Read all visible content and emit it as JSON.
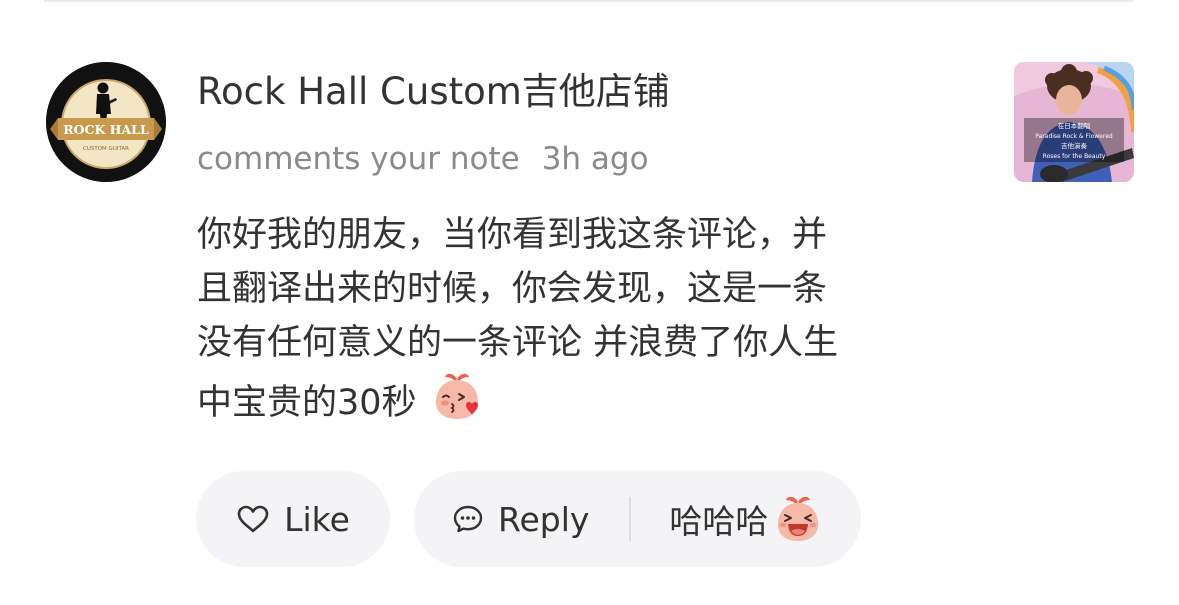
{
  "comment": {
    "avatar": {
      "icon": "rock-hall-logo-icon",
      "brand_text": "ROCK HALL",
      "sub_text": "CUSTOM GUITAR"
    },
    "author": "Rock Hall Custom吉他店铺",
    "action": "comments your note",
    "time": "3h ago",
    "text_lines": [
      "你好我的朋友，当你看到我这条评论，并",
      "且翻译出来的时候，你会发现，这是一条",
      "没有任何意义的一条评论 并浪费了你人生",
      "中宝贵的30秒"
    ],
    "text_emoji": "peach-kiss-emoji-icon"
  },
  "thumbnail": {
    "caption_lines": [
      "在日本翻唱",
      "Paradise Rock & Flowered",
      "吉他演奏",
      "Roses for the Beauty"
    ]
  },
  "actions": {
    "like_label": "Like",
    "like_icon": "heart-outline-icon",
    "reply_label": "Reply",
    "reply_icon": "chat-bubble-icon",
    "quick_reply_text": "哈哈哈",
    "quick_reply_emoji": "peach-laughing-emoji-icon"
  },
  "colors": {
    "text_primary": "#333333",
    "text_secondary": "#8a8a8a",
    "pill_background": "#f4f4f6",
    "peach": "#f6b9a7",
    "leaf": "#e8624c"
  }
}
